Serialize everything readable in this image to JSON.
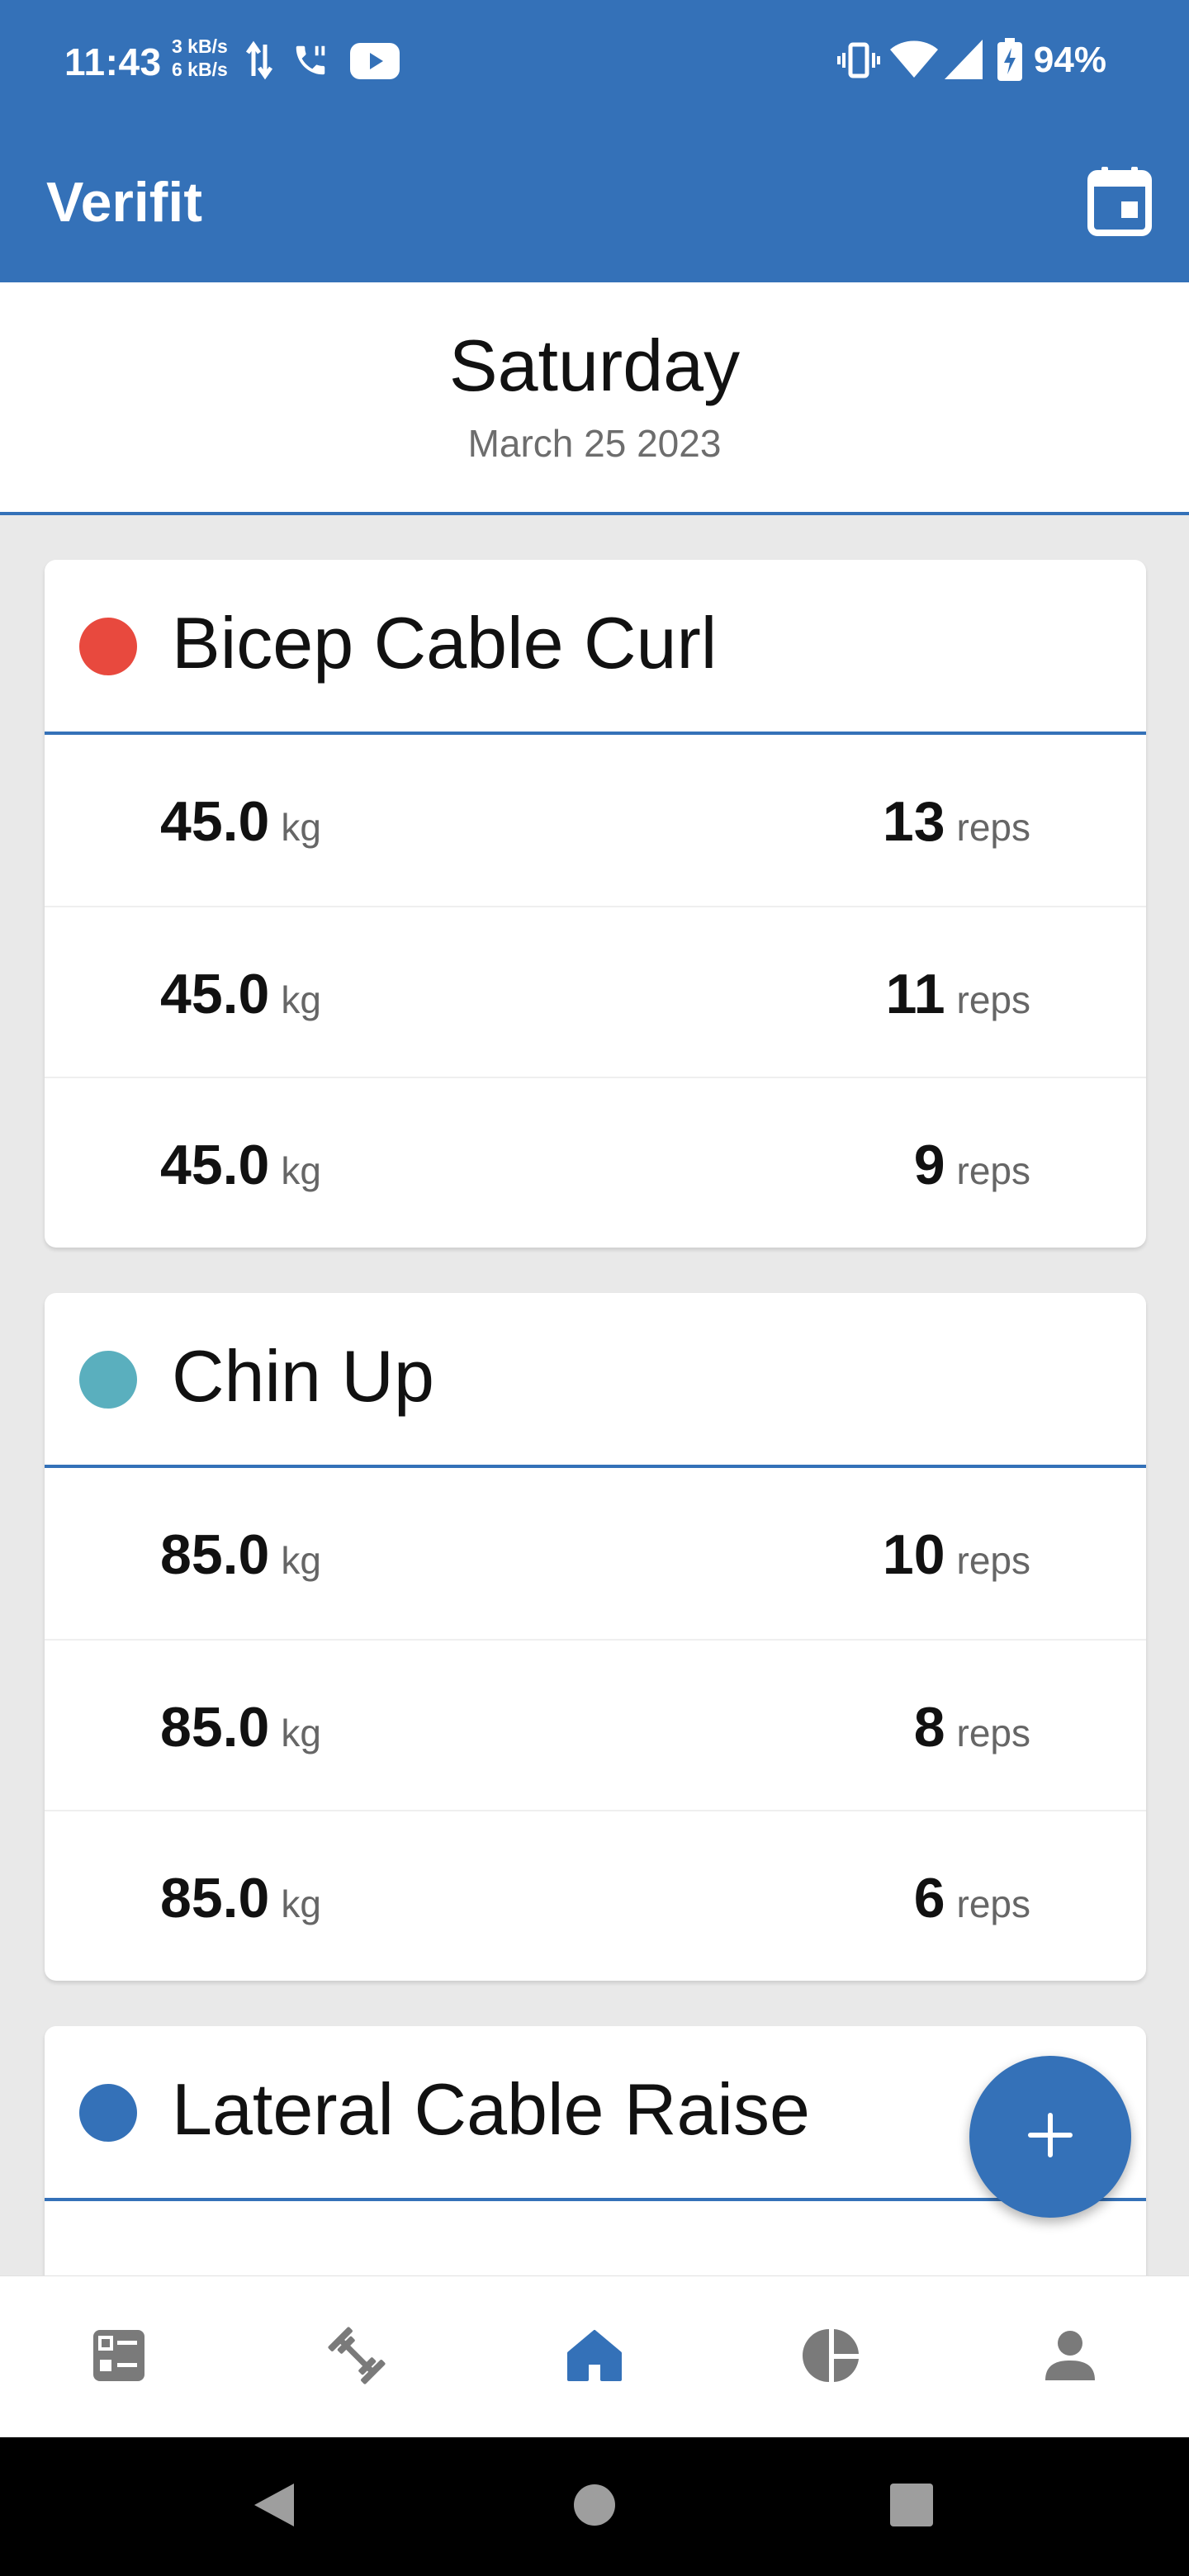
{
  "status_bar": {
    "time": "11:43",
    "net_up": "3 kB/s",
    "net_down": "6 kB/s",
    "battery_pct": "94%",
    "icons": [
      "data-transfer-icon",
      "call-icon",
      "youtube-icon",
      "vibrate-icon",
      "wifi-icon",
      "signal-icon",
      "battery-icon"
    ]
  },
  "app_bar": {
    "title": "Verifit",
    "action_icon": "calendar-icon"
  },
  "date_header": {
    "day": "Saturday",
    "date": "March 25 2023"
  },
  "exercises": [
    {
      "name": "Bicep Cable Curl",
      "color": "#e8493e",
      "sets": [
        {
          "weight": "45.0",
          "weight_unit": "kg",
          "reps": "13",
          "reps_unit": "reps"
        },
        {
          "weight": "45.0",
          "weight_unit": "kg",
          "reps": "11",
          "reps_unit": "reps"
        },
        {
          "weight": "45.0",
          "weight_unit": "kg",
          "reps": "9",
          "reps_unit": "reps"
        }
      ]
    },
    {
      "name": "Chin Up",
      "color": "#5aafbe",
      "sets": [
        {
          "weight": "85.0",
          "weight_unit": "kg",
          "reps": "10",
          "reps_unit": "reps"
        },
        {
          "weight": "85.0",
          "weight_unit": "kg",
          "reps": "8",
          "reps_unit": "reps"
        },
        {
          "weight": "85.0",
          "weight_unit": "kg",
          "reps": "6",
          "reps_unit": "reps"
        }
      ]
    },
    {
      "name": "Lateral Cable Raise",
      "color": "#3471b8",
      "sets": []
    }
  ],
  "fab": {
    "icon": "plus-icon"
  },
  "bottom_nav": {
    "items": [
      {
        "icon": "dashboard-icon",
        "active": false
      },
      {
        "icon": "dumbbell-icon",
        "active": false
      },
      {
        "icon": "home-icon",
        "active": true
      },
      {
        "icon": "pie-chart-icon",
        "active": false
      },
      {
        "icon": "profile-icon",
        "active": false
      }
    ]
  },
  "system_nav": {
    "items": [
      "back-icon",
      "home-circle-icon",
      "recents-icon"
    ]
  },
  "colors": {
    "primary": "#3471b8",
    "background": "#e9e9e9",
    "inactive_icon": "#7a7a7a"
  }
}
